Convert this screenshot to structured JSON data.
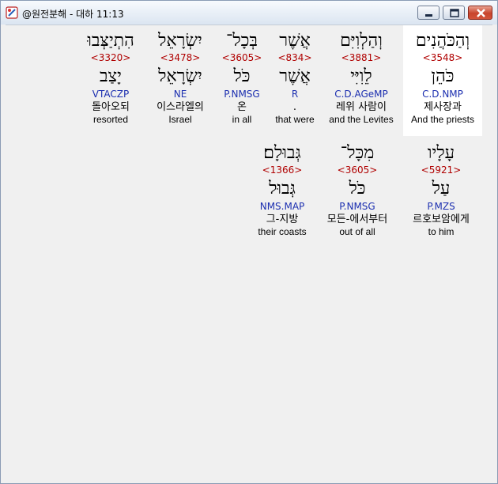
{
  "window": {
    "title": "@원전분해 - 대하 11:13"
  },
  "words": [
    {
      "hebrew": "וְהַכֹּהֲנִים",
      "strong": "<3548>",
      "lemma": "כֹּהֵן",
      "parse": "C.D.NMP",
      "korean": "제사장과",
      "gloss": "And the priests",
      "selected": true
    },
    {
      "hebrew": "וְהַלְוִיִּם",
      "strong": "<3881>",
      "lemma": "לֵוִיִּי",
      "parse": "C.D.AGeMP",
      "korean": "레위 사람이",
      "gloss": "and the Levites",
      "selected": false
    },
    {
      "hebrew": "אֲשֶׁר",
      "strong": "<834>",
      "lemma": "אֲשֶׁר",
      "parse": "R",
      "korean": ".",
      "gloss": "that were",
      "selected": false
    },
    {
      "hebrew": "בְּכָל־",
      "strong": "<3605>",
      "lemma": "כֹּל",
      "parse": "P.NMSG",
      "korean": "온",
      "gloss": "in all",
      "selected": false
    },
    {
      "hebrew": "יִשְׂרָאֵל",
      "strong": "<3478>",
      "lemma": "יִשְׂרָאֵל",
      "parse": "NE",
      "korean": "이스라엘의",
      "gloss": "Israel",
      "selected": false
    },
    {
      "hebrew": "הִתְיַצְּבוּ",
      "strong": "<3320>",
      "lemma": "יָצַב",
      "parse": "VTACZP",
      "korean": "돌아오되",
      "gloss": "resorted",
      "selected": false
    },
    {
      "hebrew": "עָלָיו",
      "strong": "<5921>",
      "lemma": "עַל",
      "parse": "P.MZS",
      "korean": "르호보암에게",
      "gloss": "to him",
      "selected": false
    },
    {
      "hebrew": "מִכָּל־",
      "strong": "<3605>",
      "lemma": "כֹּל",
      "parse": "P.NMSG",
      "korean": "모든-에서부터",
      "gloss": "out of all",
      "selected": false
    },
    {
      "hebrew": "גְּבוּלָם׃",
      "strong": "<1366>",
      "lemma": "גְּבוּל",
      "parse": "NMS.MAP",
      "korean": "그-지방",
      "gloss": "their coasts",
      "selected": false
    }
  ]
}
